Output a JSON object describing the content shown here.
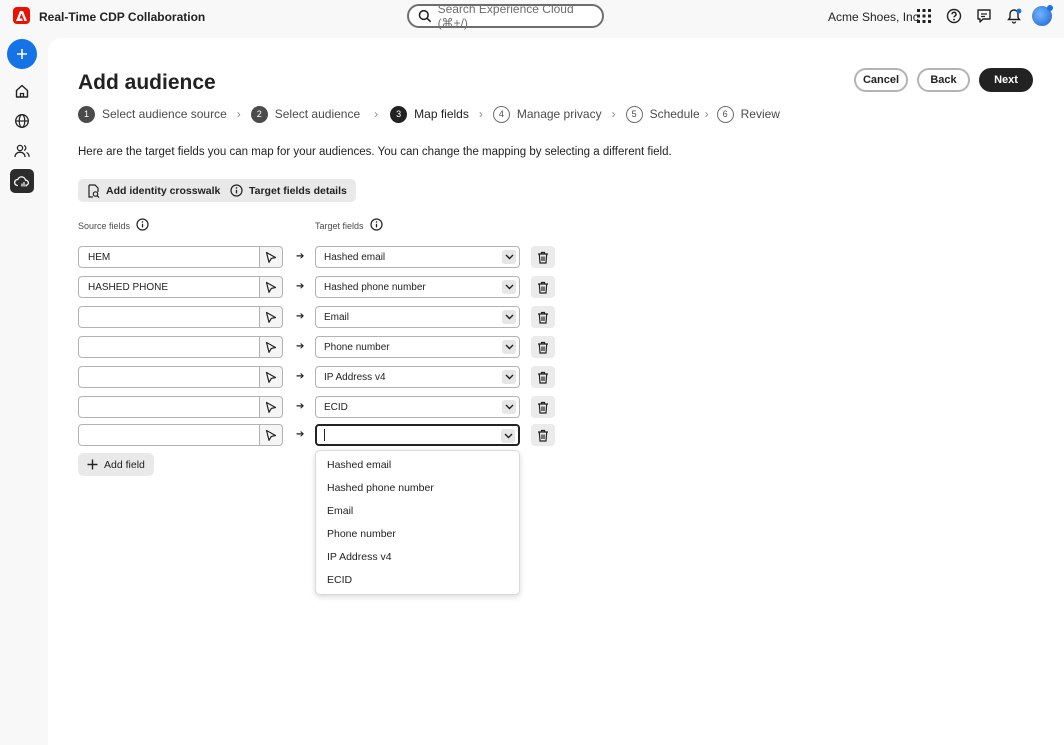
{
  "app": {
    "title": "Real-Time CDP Collaboration",
    "org": "Acme Shoes, Inc"
  },
  "search": {
    "placeholder": "Search Experience Cloud (⌘+/)"
  },
  "header_icons": [
    "apps-grid-icon",
    "help-icon",
    "feedback-icon",
    "notifications-icon"
  ],
  "rail": {
    "items": [
      "home-icon",
      "globe-icon",
      "audiences-icon",
      "cloud-connections-icon"
    ],
    "active": "cloud-connections-icon",
    "expand_label": "»"
  },
  "page": {
    "title": "Add audience",
    "description": "Here are the target fields you can map for your audiences. You can change the mapping by selecting a different field."
  },
  "buttons": {
    "cancel": "Cancel",
    "back": "Back",
    "next": "Next",
    "add_crosswalk": "Add identity crosswalk",
    "target_details": "Target fields details",
    "add_field": "Add field"
  },
  "steps": [
    {
      "num": "1",
      "label": "Select audience source",
      "state": "done"
    },
    {
      "num": "2",
      "label": "Select audience",
      "state": "done"
    },
    {
      "num": "3",
      "label": "Map fields",
      "state": "current"
    },
    {
      "num": "4",
      "label": "Manage privacy",
      "state": "todo"
    },
    {
      "num": "5",
      "label": "Schedule",
      "state": "todo"
    },
    {
      "num": "6",
      "label": "Review",
      "state": "todo"
    }
  ],
  "columns": {
    "source": "Source fields",
    "target": "Target fields"
  },
  "mappings": [
    {
      "source": "HEM",
      "target": "Hashed email"
    },
    {
      "source": "HASHED PHONE",
      "target": "Hashed phone number"
    },
    {
      "source": "",
      "target": "Email"
    },
    {
      "source": "",
      "target": "Phone number"
    },
    {
      "source": "",
      "target": "IP Address v4"
    },
    {
      "source": "",
      "target": "ECID"
    },
    {
      "source": "",
      "target": ""
    }
  ],
  "dropdown_options": [
    "Hashed email",
    "Hashed phone number",
    "Email",
    "Phone number",
    "IP Address v4",
    "ECID"
  ],
  "colors": {
    "brand": "#eb1000",
    "accent": "#1473e6",
    "primary_button": "#222222"
  }
}
